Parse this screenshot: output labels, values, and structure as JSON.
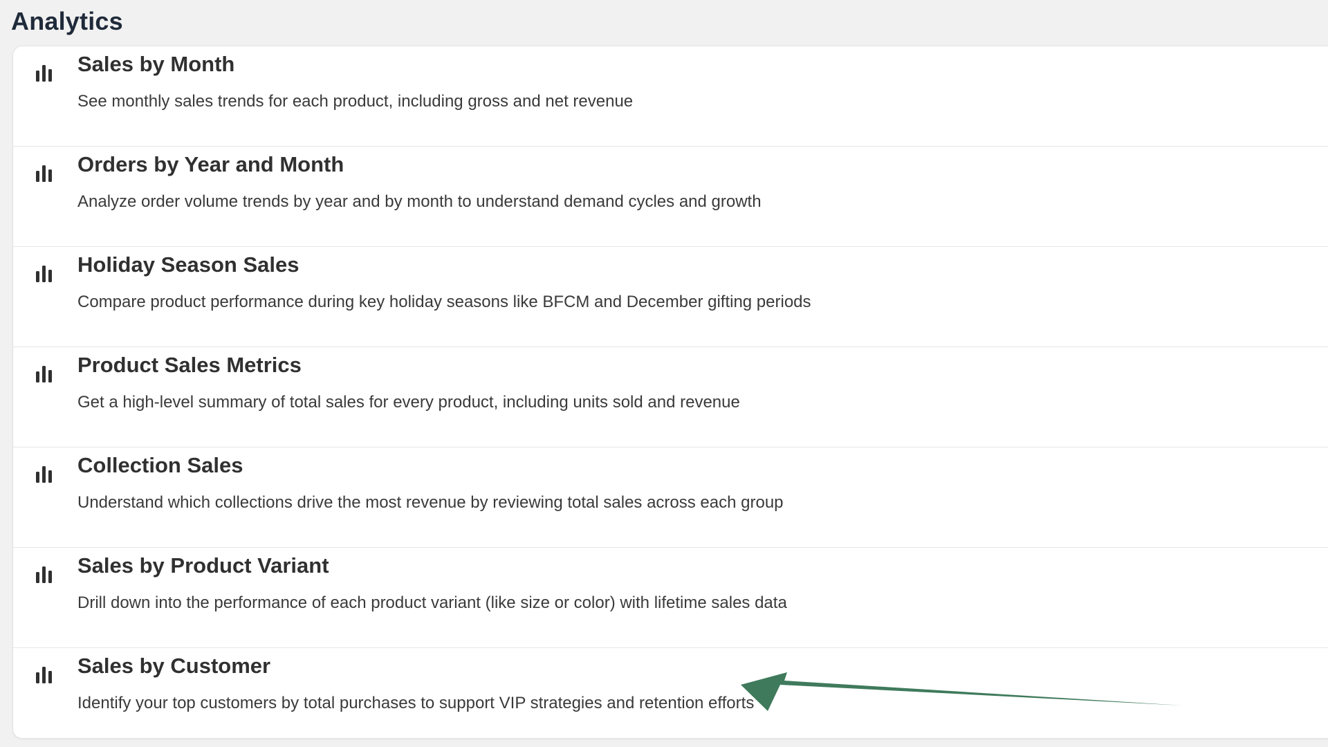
{
  "page": {
    "title": "Analytics"
  },
  "reports": [
    {
      "title": "Sales by Month",
      "description": "See monthly sales trends for each product, including gross and net revenue",
      "icon": "bar-chart-icon"
    },
    {
      "title": "Orders by Year and Month",
      "description": "Analyze order volume trends by year and by month to understand demand cycles and growth",
      "icon": "bar-chart-icon"
    },
    {
      "title": "Holiday Season Sales",
      "description": "Compare product performance during key holiday seasons like BFCM and December gifting periods",
      "icon": "bar-chart-icon"
    },
    {
      "title": "Product Sales Metrics",
      "description": "Get a high-level summary of total sales for every product, including units sold and revenue",
      "icon": "bar-chart-icon"
    },
    {
      "title": "Collection Sales",
      "description": "Understand which collections drive the most revenue by reviewing total sales across each group",
      "icon": "bar-chart-icon"
    },
    {
      "title": "Sales by Product Variant",
      "description": "Drill down into the performance of each product variant (like size or color) with lifetime sales data",
      "icon": "bar-chart-icon"
    },
    {
      "title": "Sales by Customer",
      "description": "Identify your top customers by total purchases to support VIP strategies and retention efforts",
      "icon": "bar-chart-icon"
    }
  ],
  "colors": {
    "background": "#f1f1f1",
    "card": "#ffffff",
    "text": "#303030",
    "annotation_arrow": "#3f7a5c"
  }
}
